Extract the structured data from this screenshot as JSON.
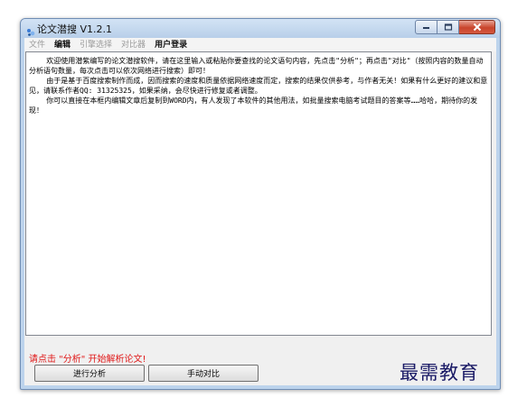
{
  "window": {
    "title": "论文潜搜 V1.2.1"
  },
  "menu": {
    "items": [
      {
        "label": "文件",
        "state": "disabled"
      },
      {
        "label": "编辑",
        "state": "bold"
      },
      {
        "label": "引擎选择",
        "state": "disabled"
      },
      {
        "label": "对比器",
        "state": "disabled"
      },
      {
        "label": "用户登录",
        "state": "bold"
      }
    ]
  },
  "content": {
    "paragraphs": [
      "    欢迎使用潜紫编写的论文潜搜软件，请在这里输入或粘贴你要查找的论文语句内容，先点击\"分析\"；再点击\"对比\"（按照内容的数量自动分析语句数量，每次点击可以依次网络进行搜索）即可！",
      "    由于是基于百度搜索制作而成，因而搜索的速度和质量依据网络速度而定，搜索的结果仅供参考，与作者无关！如果有什么更好的建议和意见，请联系作者QQ: 31325325，如果采纳，会尽快进行修复或者调整。",
      "    你可以直接在本框内编辑文章后复制到WORD内，有人发现了本软件的其他用法，如批量搜索电脑考试题目的答案等……哈哈，期待你的发现！"
    ]
  },
  "status": {
    "message": "请点击 \"分析\" 开始解析论文!",
    "color": "#e01818"
  },
  "buttons": {
    "analyze": "进行分析",
    "compare": "手动对比"
  },
  "watermark": {
    "text": "最需教育"
  }
}
